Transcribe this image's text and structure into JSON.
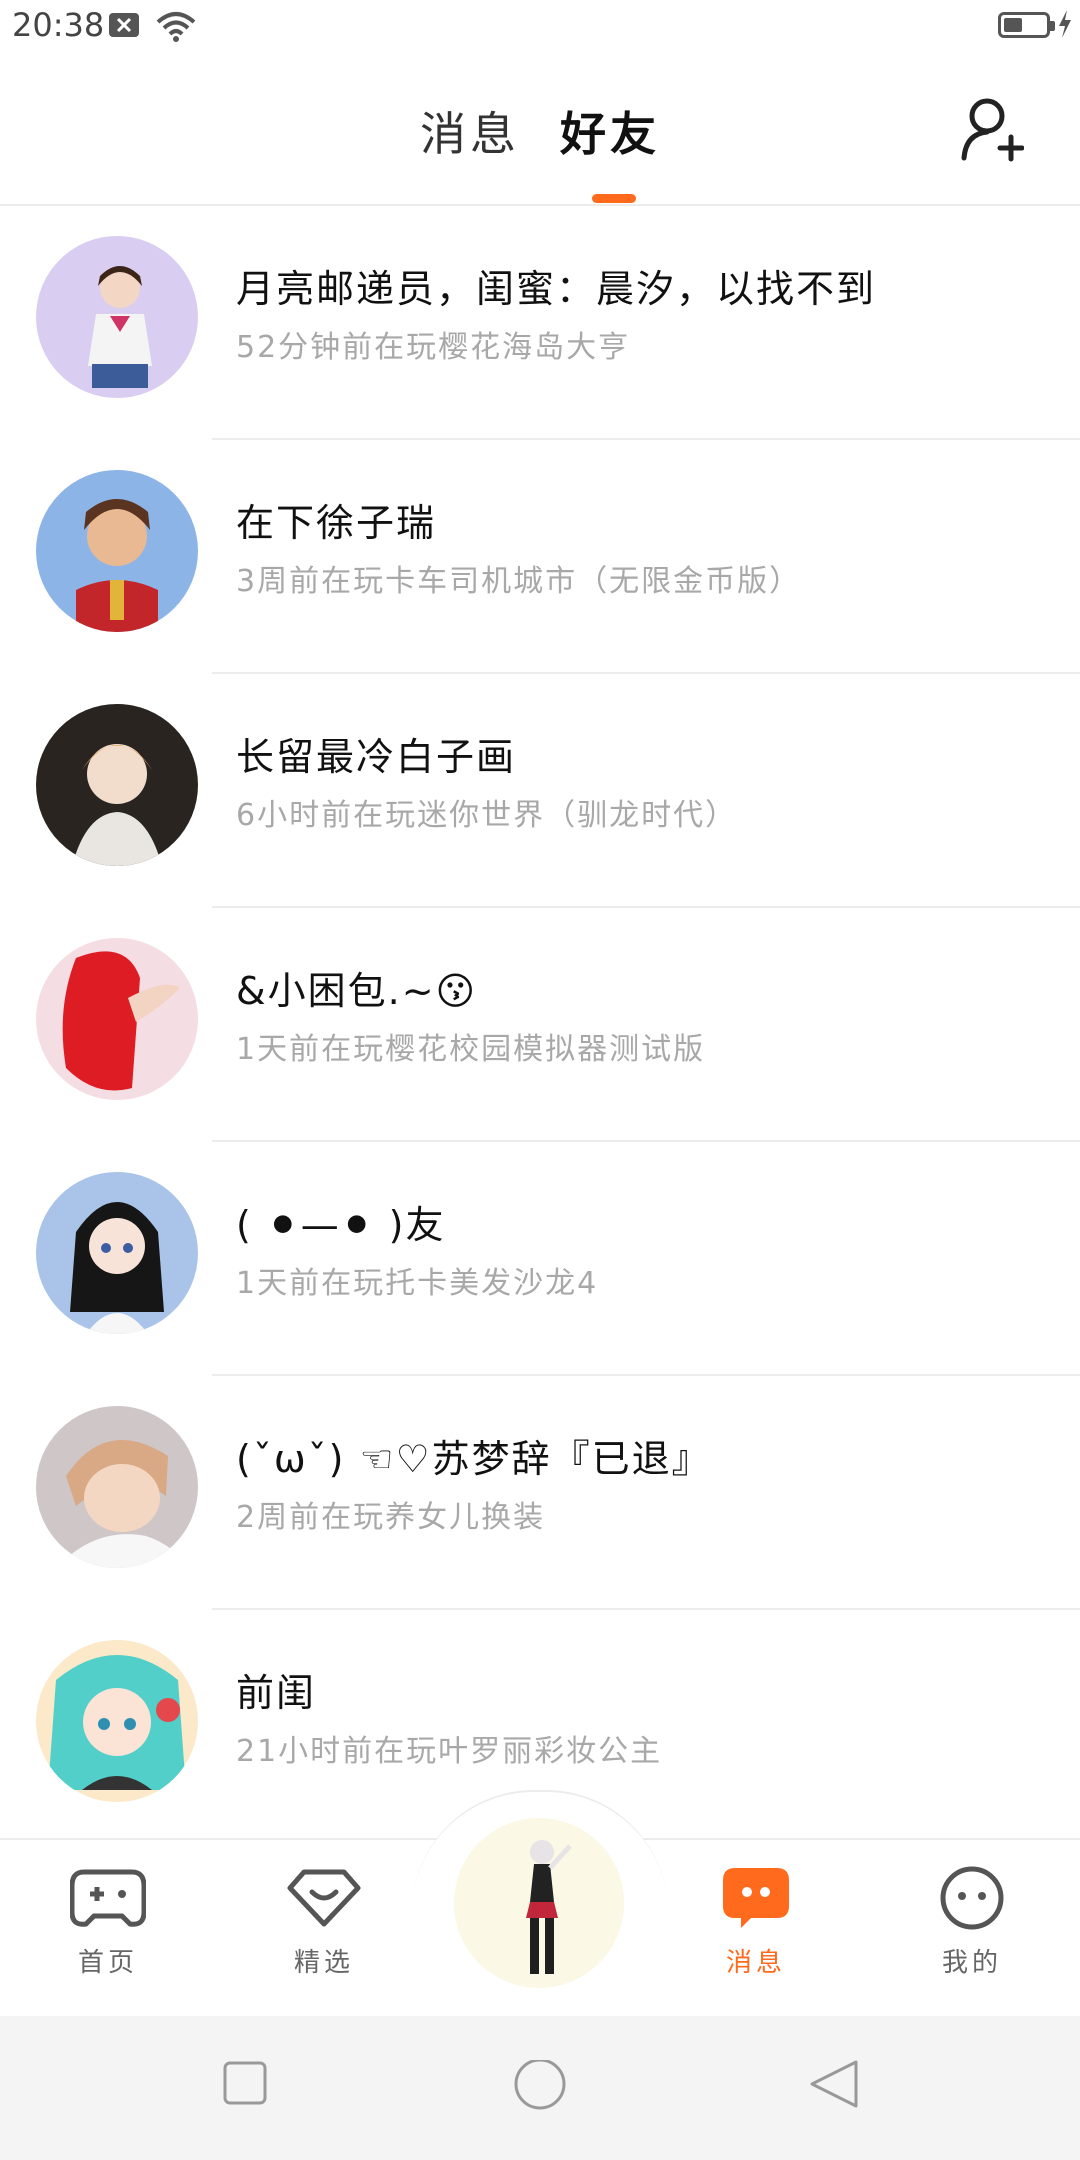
{
  "status_bar": {
    "time": "20:38"
  },
  "header": {
    "tabs": [
      {
        "label": "消息",
        "active": false
      },
      {
        "label": "好友",
        "active": true
      }
    ],
    "accent": "#ff6a1c"
  },
  "friends": [
    {
      "name": "月亮邮递员，闺蜜：晨汐，以找不到",
      "status": "52分钟前在玩樱花海岛大亨"
    },
    {
      "name": "在下徐子瑞",
      "status": "3周前在玩卡车司机城市（无限金币版）"
    },
    {
      "name": "长留最冷白子画",
      "status": "6小时前在玩迷你世界（驯龙时代）"
    },
    {
      "name": "&小困包.~😗",
      "status": "1天前在玩樱花校园模拟器测试版"
    },
    {
      "name": "( ⚫—⚫ )友",
      "status": "1天前在玩托卡美发沙龙4"
    },
    {
      "name": "(ˇωˇ) ☜♡苏梦辞『已退』",
      "status": "2周前在玩养女儿换装"
    },
    {
      "name": " 前闺",
      "status": "21小时前在玩叶罗丽彩妆公主"
    }
  ],
  "bottom_nav": {
    "items": [
      {
        "label": "首页",
        "icon": "gamepad-icon"
      },
      {
        "label": "精选",
        "icon": "heart-diamond-icon"
      },
      {
        "label": "消息",
        "icon": "chat-bubble-icon",
        "active": true
      },
      {
        "label": "我的",
        "icon": "face-icon"
      }
    ]
  }
}
